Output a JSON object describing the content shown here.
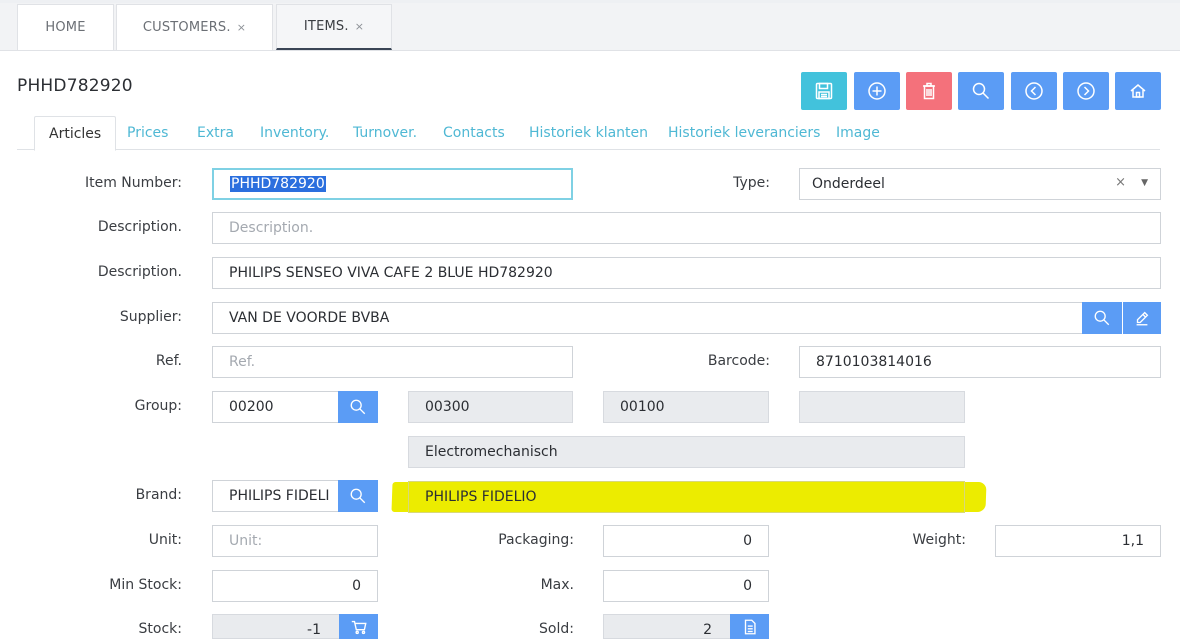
{
  "tabs": [
    {
      "label": "HOME",
      "closable": false
    },
    {
      "label": "CUSTOMERS.",
      "closable": true
    },
    {
      "label": "ITEMS.",
      "closable": true
    }
  ],
  "close_glyph": "×",
  "record_title": "PHHD782920",
  "toolbar": {
    "icons": [
      "save-icon",
      "add-icon",
      "delete-icon",
      "search-icon",
      "previous-icon",
      "next-icon",
      "home-icon"
    ]
  },
  "subtabs": [
    "Articles",
    "Prices",
    "Extra",
    "Inventory.",
    "Turnover.",
    "Contacts",
    "Historiek klanten",
    "Historiek leveranciers",
    "Image"
  ],
  "form": {
    "item_number": {
      "label": "Item Number:",
      "value": "PHHD782920"
    },
    "type": {
      "label": "Type:",
      "value": "Onderdeel",
      "clear_glyph": "×",
      "arrow_glyph": "▼"
    },
    "description1": {
      "label": "Description.",
      "placeholder": "Description."
    },
    "description2": {
      "label": "Description.",
      "value": "PHILIPS SENSEO VIVA CAFE 2 BLUE HD782920"
    },
    "supplier": {
      "label": "Supplier:",
      "value": "VAN DE VOORDE BVBA"
    },
    "ref": {
      "label": "Ref.",
      "placeholder": "Ref."
    },
    "barcode": {
      "label": "Barcode:",
      "value": "8710103814016"
    },
    "group": {
      "label": "Group:",
      "value": "00200",
      "sub1": "00300",
      "sub2": "00100",
      "sub3": "",
      "name": "Electromechanisch"
    },
    "brand": {
      "label": "Brand:",
      "value": "PHILIPS FIDELI",
      "name": "PHILIPS FIDELIO"
    },
    "unit": {
      "label": "Unit:",
      "placeholder": "Unit:"
    },
    "packaging": {
      "label": "Packaging:",
      "value": "0"
    },
    "weight": {
      "label": "Weight:",
      "value": "1,1"
    },
    "min_stock": {
      "label": "Min Stock:",
      "value": "0"
    },
    "max": {
      "label": "Max.",
      "value": "0"
    },
    "stock": {
      "label": "Stock:",
      "value": "-1"
    },
    "sold": {
      "label": "Sold:",
      "value": "2"
    }
  },
  "colors": {
    "accent_teal": "#42c2dc",
    "accent_blue": "#5b9cf5",
    "accent_red": "#f4717b",
    "highlight": "#ecec00"
  }
}
